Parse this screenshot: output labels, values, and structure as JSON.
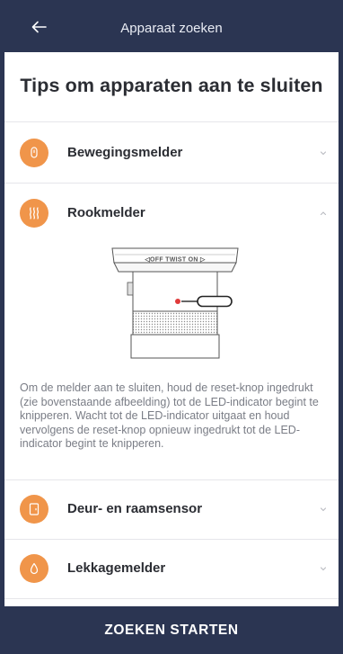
{
  "header": {
    "title": "Apparaat zoeken",
    "back_icon": "arrow-left-icon"
  },
  "page_title": "Tips om apparaten aan te sluiten",
  "accent_color": "#f0954a",
  "nav_color": "#2b3552",
  "sections": [
    {
      "label": "Bewegingsmelder",
      "icon": "motion-sensor-icon",
      "expanded": false
    },
    {
      "label": "Rookmelder",
      "icon": "smoke-wave-icon",
      "expanded": true
    },
    {
      "label": "Deur- en raamsensor",
      "icon": "door-sensor-icon",
      "expanded": false
    },
    {
      "label": "Lekkagemelder",
      "icon": "water-drop-icon",
      "expanded": false
    }
  ],
  "smoke_detector": {
    "dial_label": "◁OFF TWIST ON ▷",
    "description": "Om de melder aan te sluiten, houd de reset-knop ingedrukt (zie bovenstaande afbeelding) tot de LED-indicator begint te knipperen. Wacht tot de LED-indicator uitgaat en houd vervolgens de reset-knop opnieuw ingedrukt tot de LED-indicator begint te knipperen."
  },
  "footer": {
    "button_label": "ZOEKEN STARTEN"
  }
}
